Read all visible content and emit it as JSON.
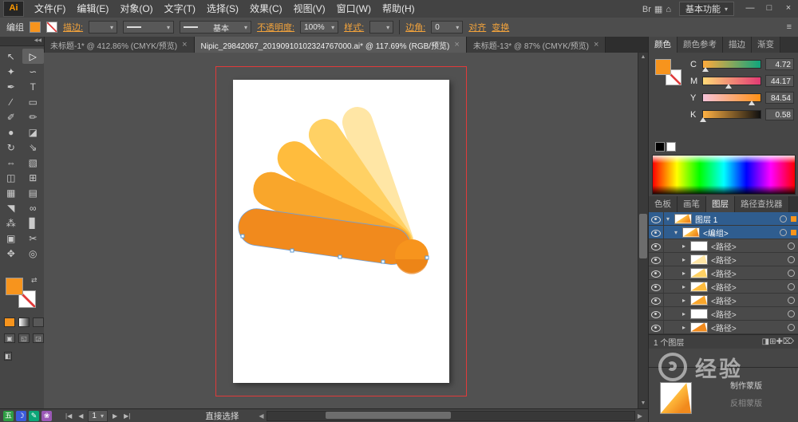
{
  "colors": {
    "accent": "#f2a33c",
    "current_fill": "#f7941d",
    "selection_blue": "#2f5d8f",
    "artboard_guide_red": "#e03a3a",
    "logo_petals": [
      "#ffe6a5",
      "#ffd164",
      "#ffbc3d",
      "#f9a62b",
      "#f18a1d"
    ],
    "logo_ball": "#f7941d"
  },
  "icons": {
    "caret": "▾",
    "close": "×",
    "menu": "≡",
    "collapse": "◀◀",
    "first": "|◀",
    "prev": "◀",
    "next": "▶",
    "last": "▶|",
    "left": "◀",
    "right": "▶",
    "up": "▲",
    "down": "▼",
    "swap": "⇄"
  },
  "menubar": {
    "logo": "Ai",
    "items": [
      "文件(F)",
      "编辑(E)",
      "对象(O)",
      "文字(T)",
      "选择(S)",
      "效果(C)",
      "视图(V)",
      "窗口(W)",
      "帮助(H)"
    ],
    "right_icons": [
      {
        "name": "bridge-icon",
        "glyph": "Br"
      },
      {
        "name": "arrange-documents-icon",
        "glyph": "▦"
      },
      {
        "name": "workspace-switch-icon",
        "glyph": "⌂"
      }
    ],
    "workspace": "基本功能",
    "window_buttons": [
      {
        "name": "minimize-button",
        "glyph": "—"
      },
      {
        "name": "restore-button",
        "glyph": "□"
      },
      {
        "name": "close-button",
        "glyph": "×"
      }
    ]
  },
  "control_bar": {
    "context": "编组",
    "stroke_label": "描边:",
    "brush_definition": "基本",
    "opacity_label": "不透明度:",
    "opacity_value": "100%",
    "style_label": "样式:",
    "corner_label": "边角:",
    "corner_value": "0",
    "align_label": "对齐",
    "transform_label": "变换"
  },
  "document_tabs": [
    {
      "title": "未标题-1* @ 412.86% (CMYK/预览)",
      "active": false
    },
    {
      "title": "Nipic_29842067_20190910102324767000.ai* @ 117.69% (RGB/预览)",
      "active": true
    },
    {
      "title": "未标题-13* @ 87% (CMYK/预览)",
      "active": false
    }
  ],
  "tools": [
    {
      "name": "selection-tool",
      "glyph": "↖"
    },
    {
      "name": "direct-selection-tool",
      "glyph": "▷",
      "active": true
    },
    {
      "name": "magic-wand-tool",
      "glyph": "✦"
    },
    {
      "name": "lasso-tool",
      "glyph": "∽"
    },
    {
      "name": "pen-tool",
      "glyph": "✒"
    },
    {
      "name": "type-tool",
      "glyph": "T"
    },
    {
      "name": "line-segment-tool",
      "glyph": "∕"
    },
    {
      "name": "rectangle-tool",
      "glyph": "▭"
    },
    {
      "name": "paintbrush-tool",
      "glyph": "✐"
    },
    {
      "name": "pencil-tool",
      "glyph": "✏"
    },
    {
      "name": "blob-brush-tool",
      "glyph": "●"
    },
    {
      "name": "eraser-tool",
      "glyph": "◪"
    },
    {
      "name": "rotate-tool",
      "glyph": "↻"
    },
    {
      "name": "scale-tool",
      "glyph": "⇘"
    },
    {
      "name": "width-tool",
      "glyph": "⇔"
    },
    {
      "name": "free-transform-tool",
      "glyph": "▧"
    },
    {
      "name": "shape-builder-tool",
      "glyph": "◫"
    },
    {
      "name": "perspective-grid-tool",
      "glyph": "⊞"
    },
    {
      "name": "mesh-tool",
      "glyph": "▦"
    },
    {
      "name": "gradient-tool",
      "glyph": "▤"
    },
    {
      "name": "eyedropper-tool",
      "glyph": "◥"
    },
    {
      "name": "blend-tool",
      "glyph": "∞"
    },
    {
      "name": "symbol-sprayer-tool",
      "glyph": "⁂"
    },
    {
      "name": "column-graph-tool",
      "glyph": "▊"
    },
    {
      "name": "artboard-tool",
      "glyph": "▣"
    },
    {
      "name": "slice-tool",
      "glyph": "✂"
    },
    {
      "name": "hand-tool",
      "glyph": "✥"
    },
    {
      "name": "zoom-tool",
      "glyph": "◎"
    }
  ],
  "color_panel": {
    "tabs": [
      "颜色",
      "颜色参考",
      "描边",
      "渐变"
    ],
    "active_index": 0,
    "channels": [
      {
        "label": "C",
        "value": "4.72",
        "gradient": [
          "#ffaa3c",
          "#0fa57d"
        ]
      },
      {
        "label": "M",
        "value": "44.17",
        "gradient": [
          "#ffd977",
          "#e23a74"
        ]
      },
      {
        "label": "Y",
        "value": "84.54",
        "gradient": [
          "#f6c3d9",
          "#ff9015"
        ]
      },
      {
        "label": "K",
        "value": "0.58",
        "gradient": [
          "#ffb143",
          "#101010"
        ]
      }
    ]
  },
  "dock_tabs": {
    "items": [
      "色板",
      "画笔",
      "图层",
      "路径查找器"
    ],
    "active_index": 2
  },
  "layers_panel": {
    "rows": [
      {
        "name": "图层 1",
        "indent": 0,
        "caret": "▾",
        "selected": true,
        "thumb": "logo"
      },
      {
        "name": "<编组>",
        "indent": 1,
        "caret": "▾",
        "selected": true,
        "thumb": "logo"
      },
      {
        "name": "<路径>",
        "indent": 2,
        "caret": "▸",
        "selected": false,
        "thumb": "#ffffff"
      },
      {
        "name": "<路径>",
        "indent": 2,
        "caret": "▸",
        "selected": false,
        "thumb": "#ffe6a5"
      },
      {
        "name": "<路径>",
        "indent": 2,
        "caret": "▸",
        "selected": false,
        "thumb": "#ffd164"
      },
      {
        "name": "<路径>",
        "indent": 2,
        "caret": "▸",
        "selected": false,
        "thumb": "#ffbc3d"
      },
      {
        "name": "<路径>",
        "indent": 2,
        "caret": "▸",
        "selected": false,
        "thumb": "#f9a62b"
      },
      {
        "name": "<路径>",
        "indent": 2,
        "caret": "▸",
        "selected": false,
        "thumb": "#ffffff"
      },
      {
        "name": "<路径>",
        "indent": 2,
        "caret": "▸",
        "selected": false,
        "thumb": "#f18a1d"
      }
    ],
    "status": "1 个图层",
    "footer_icons": [
      {
        "name": "make-clip-mask-icon",
        "glyph": "◨"
      },
      {
        "name": "new-sublayer-icon",
        "glyph": "⊞"
      },
      {
        "name": "new-layer-icon",
        "glyph": "✚"
      },
      {
        "name": "delete-layer-icon",
        "glyph": "⌦"
      }
    ]
  },
  "transparency_panel": {
    "make_mask_label": "制作蒙版",
    "invert_mask_label": "反相蒙版"
  },
  "status_bar": {
    "tray_icons": [
      {
        "glyph": "五",
        "color": "#2f9e44"
      },
      {
        "glyph": "☽",
        "color": "#3b5bdb"
      },
      {
        "glyph": "✎",
        "color": "#0ca678"
      },
      {
        "glyph": "❀",
        "color": "#9b59b6"
      }
    ],
    "artboard_number": "1",
    "tool_name": "直接选择"
  },
  "watermark": {
    "text": "经验"
  }
}
